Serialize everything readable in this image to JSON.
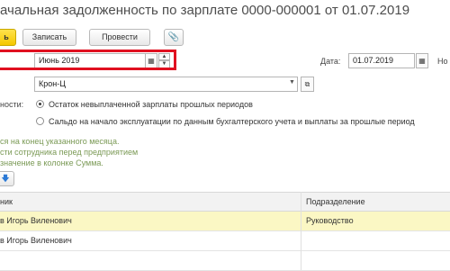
{
  "title": "ачальная задолженность по зарплате 0000-000001 от 01.07.2019",
  "toolbar": {
    "post_close_label": "ь",
    "save_label": "Записать",
    "post_label": "Провести"
  },
  "period": {
    "value": "Июнь 2019"
  },
  "date": {
    "label": "Дата:",
    "value": "01.07.2019",
    "next_label": "Но"
  },
  "organization": {
    "value": "Крон-Ц"
  },
  "balance_option": {
    "label": "ности:",
    "options": [
      "Остаток невыплаченной зарплаты прошлых периодов",
      "Сальдо на начало эксплуатации по данным бухгалтерского учета и выплаты за прошлые период"
    ],
    "selected": 0
  },
  "hints": [
    "ся на конец указанного месяца.",
    "сти сотрудника перед предприятием",
    "значение в колонке Сумма."
  ],
  "table": {
    "columns": [
      "ник",
      "Подразделение"
    ],
    "rows": [
      {
        "employee": "в Игорь Виленович",
        "department": "Руководство",
        "selected": true
      },
      {
        "employee": "в Игорь Виленович",
        "department": "",
        "selected": false
      }
    ]
  }
}
